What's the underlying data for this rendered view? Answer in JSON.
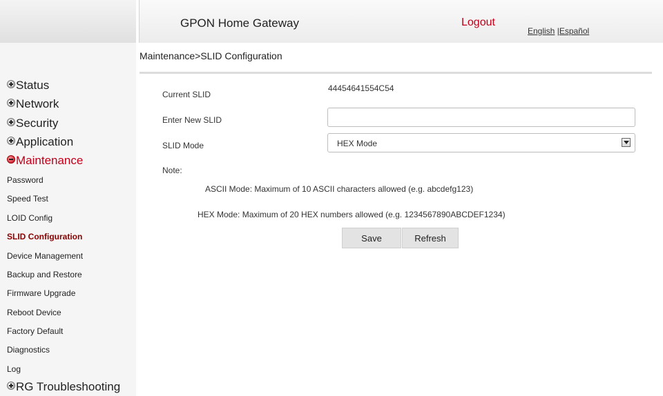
{
  "header": {
    "title": "GPON Home Gateway",
    "logout": "Logout",
    "lang_english": "English",
    "lang_separator": " |",
    "lang_espanol": "Español"
  },
  "breadcrumb": "Maintenance>SLID Configuration",
  "sidebar": {
    "status": "Status",
    "network": "Network",
    "security": "Security",
    "application": "Application",
    "maintenance": "Maintenance",
    "sub": [
      "Password",
      "Speed Test",
      "LOID Config",
      "SLID Configuration",
      "Device Management",
      "Backup and Restore",
      "Firmware Upgrade",
      "Reboot Device",
      "Factory Default",
      "Diagnostics",
      "Log"
    ],
    "rg_troubleshooting": "RG Troubleshooting"
  },
  "form": {
    "current_slid_label": "Current SLID",
    "current_slid_value": "44454641554C54",
    "new_slid_label": "Enter New SLID",
    "new_slid_value": "",
    "mode_label": "SLID Mode",
    "mode_value": "HEX Mode",
    "note_label": "Note:",
    "note_ascii": "ASCII Mode: Maximum of 10 ASCII characters allowed (e.g. abcdefg123)",
    "note_hex": "HEX Mode: Maximum of 20 HEX numbers allowed (e.g. 1234567890ABCDEF1234)",
    "save": "Save",
    "refresh": "Refresh"
  }
}
